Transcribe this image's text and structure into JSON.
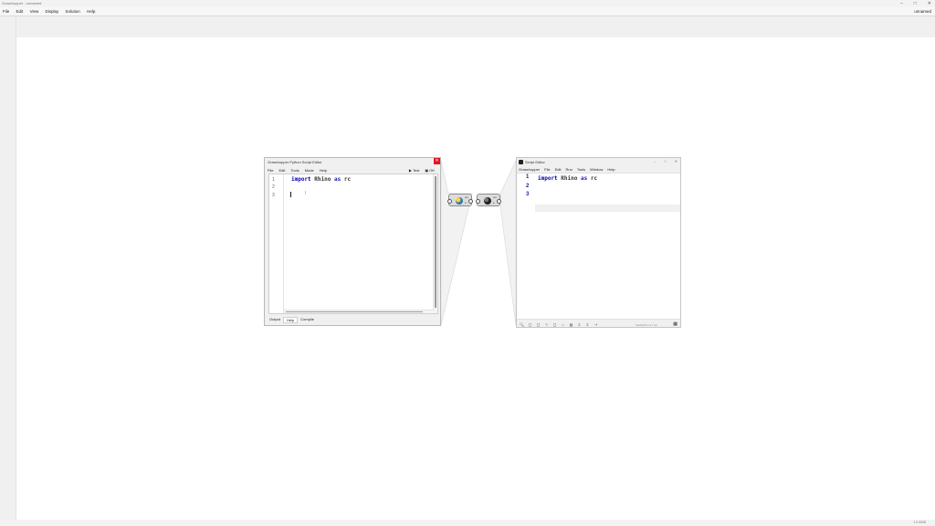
{
  "app": {
    "title": "Grasshopper - unnamed",
    "window_controls": [
      "–",
      "□",
      "✕"
    ],
    "menu": [
      "File",
      "Edit",
      "View",
      "Display",
      "Solution",
      "Help"
    ],
    "document_name": "unnamed",
    "status_version": "1.0.0008"
  },
  "gh_editor": {
    "title": "Grasshopper Python Script Editor",
    "close_glyph": "✕",
    "menu": [
      "File",
      "Edit",
      "Tools",
      "Mode",
      "Help"
    ],
    "test_label": "Test",
    "ok_label": "OK",
    "line_numbers": [
      "1",
      "2",
      "3"
    ],
    "code": {
      "kw_import": "import",
      "module": " Rhino ",
      "kw_as": "as",
      "alias": " rc"
    },
    "ibeam_glyph": "I",
    "tabs": [
      "Output",
      "Help",
      "Compile"
    ],
    "active_tab": "Help"
  },
  "components": [
    {
      "name": "python-component",
      "label_top": "out",
      "label_bottom": "a"
    },
    {
      "name": "ghpython-component",
      "label_top": "out",
      "label_bottom": "a"
    }
  ],
  "rhino_editor": {
    "title": "Script Editor",
    "window_controls": [
      "–",
      "□",
      "✕"
    ],
    "menu": [
      "Grasshopper",
      "File",
      "Edit",
      "Run",
      "Tools",
      "Window",
      "Help"
    ],
    "line_numbers": [
      "1",
      "2",
      "3"
    ],
    "code": {
      "kw_import": "import",
      "module": " Rhino ",
      "kw_as": "as",
      "alias": " rc"
    },
    "toolbar_glyphs": [
      "🔍",
      "▢",
      "▢",
      "?",
      "▢",
      "○",
      "▤",
      "Σ",
      "Σ",
      "⊣"
    ],
    "version_label": "IronPython 2.7.12",
    "calendar_glyph": "▦"
  }
}
